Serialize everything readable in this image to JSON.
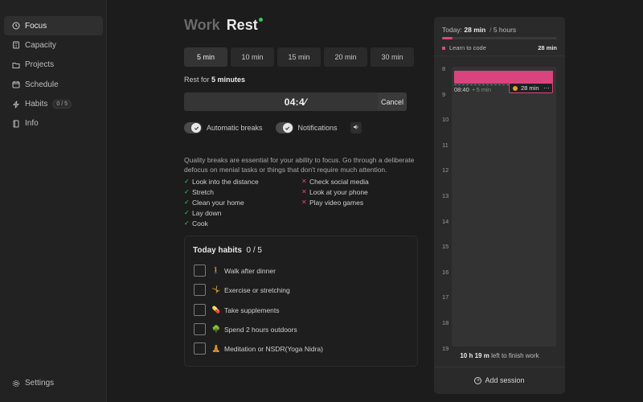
{
  "sidebar": {
    "items": [
      {
        "label": "Focus",
        "icon": "clock-icon",
        "active": true
      },
      {
        "label": "Capacity",
        "icon": "calculator-icon"
      },
      {
        "label": "Projects",
        "icon": "folder-icon"
      },
      {
        "label": "Schedule",
        "icon": "calendar-icon"
      },
      {
        "label": "Habits",
        "icon": "bolt-icon",
        "badge": "0 / 5"
      },
      {
        "label": "Info",
        "icon": "book-icon"
      }
    ],
    "settings_label": "Settings"
  },
  "mode": {
    "work": "Work",
    "rest": "Rest"
  },
  "durations": [
    "5 min",
    "10 min",
    "15 min",
    "20 min",
    "30 min"
  ],
  "rest_for": {
    "prefix": "Rest for",
    "value": "5 minutes"
  },
  "timer": {
    "text": "04:4⁄",
    "cancel": "Cancel",
    "progress": 0.88
  },
  "toggles": {
    "automatic": "Automatic breaks",
    "notifications": "Notifications"
  },
  "description": "Quality breaks are essential for your ability to focus. Go through a deliberate defocus on menial tasks or things that don't require much attention.",
  "do_list": [
    "Look into the distance",
    "Stretch",
    "Clean your home",
    "Lay down",
    "Cook"
  ],
  "dont_list": [
    "Check social media",
    "Look at your phone",
    "Play video games"
  ],
  "habits": {
    "title": "Today habits",
    "count": "0 / 5",
    "items": [
      {
        "emoji": "🚶",
        "label": "Walk after dinner"
      },
      {
        "emoji": "🤸",
        "label": "Exercise or stretching"
      },
      {
        "emoji": "💊",
        "label": "Take supplements"
      },
      {
        "emoji": "🌳",
        "label": "Spend 2 hours outdoors"
      },
      {
        "emoji": "🧘",
        "label": "Meditation or NSDR(Yoga Nidra)"
      }
    ]
  },
  "panel": {
    "today_label": "Today:",
    "today_value": "28 min",
    "total": "5 hours",
    "progress": 0.09,
    "task_name": "Learn to code",
    "task_value": "28 min",
    "hours": [
      "8",
      "9",
      "10",
      "11",
      "12",
      "13",
      "14",
      "15",
      "16",
      "17",
      "18",
      "19"
    ],
    "session_start": "08:40",
    "session_len": "5 min",
    "session_pill": "28 min",
    "finish_value": "10 h 19 m",
    "finish_suffix": "left to finish work",
    "add_session": "Add session"
  },
  "colors": {
    "accent": "#d9447e",
    "ok": "#3ec65a",
    "no": "#d9487f"
  }
}
